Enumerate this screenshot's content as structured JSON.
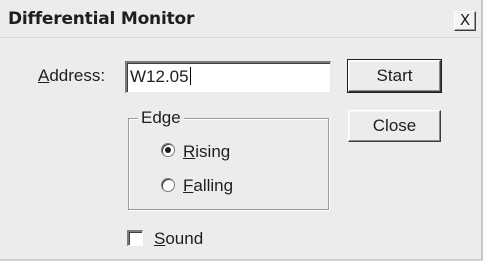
{
  "window": {
    "title": "Differential Monitor",
    "close_glyph": "X"
  },
  "address": {
    "label_mnemonic": "A",
    "label_rest": "ddress:",
    "value": "W12.05"
  },
  "buttons": {
    "start": "Start",
    "close": "Close"
  },
  "edge_group": {
    "title": "Edge",
    "options": [
      {
        "mnemonic": "R",
        "rest": "ising",
        "checked": true
      },
      {
        "mnemonic": "F",
        "rest": "alling",
        "checked": false
      }
    ]
  },
  "sound": {
    "mnemonic": "S",
    "rest": "ound",
    "checked": false
  },
  "colors": {
    "dialog_bg": "#ececec",
    "text": "#1e1e1e",
    "field_bg": "#ffffff"
  }
}
